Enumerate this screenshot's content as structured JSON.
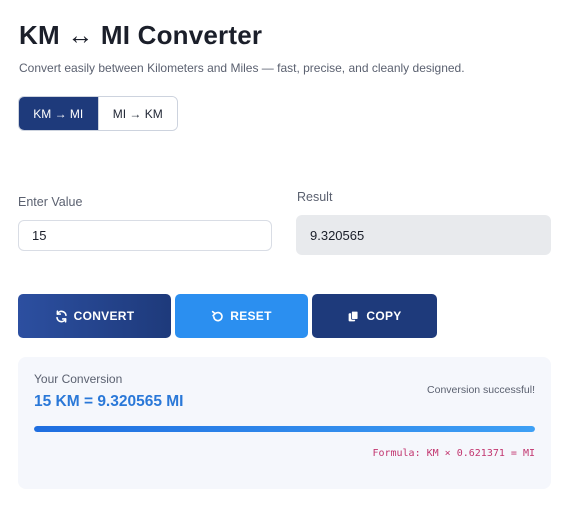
{
  "header": {
    "title": "KM ↔ MI Converter",
    "subtitle": "Convert easily between Kilometers and Miles — fast, precise, and cleanly designed."
  },
  "mode_toggle": {
    "km_to_mi": "KM → MI",
    "mi_to_km": "MI → KM",
    "selected": "KM → MI"
  },
  "form": {
    "input_label": "Enter Value",
    "input_value": "15",
    "result_label": "Result",
    "result_value": "9.320565"
  },
  "actions": {
    "convert": "CONVERT",
    "reset": "RESET",
    "copy": "COPY"
  },
  "output_card": {
    "label": "Your Conversion",
    "summary": "15 KM = 9.320565 MI",
    "status": "Conversion successful!",
    "progress": 1.0,
    "formula": "Formula: KM × 0.621371 = MI"
  },
  "colors": {
    "primary_dark": "#1e3a7b",
    "accent_blue": "#2b8ff0",
    "result_text": "#2a78d8",
    "formula_text": "#c2366f"
  }
}
